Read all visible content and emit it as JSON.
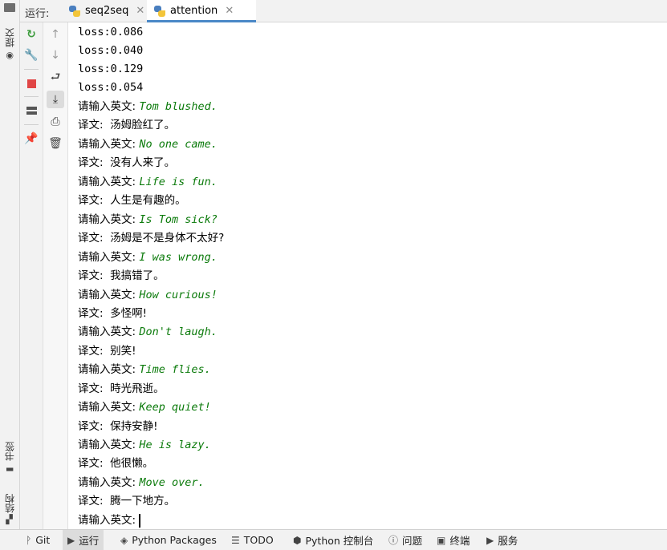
{
  "left_strip": {
    "commit_label": "提交",
    "bookmarks_label": "书签",
    "structure_label": "结构"
  },
  "tabbar": {
    "run_label": "运行:",
    "tabs": [
      {
        "label": "seq2seq",
        "active": false
      },
      {
        "label": "attention",
        "active": true
      }
    ]
  },
  "toolbar": {
    "icons": [
      "rerun-icon",
      "settings-wrench-icon",
      "stop-icon",
      "layout-icon",
      "pin-icon"
    ],
    "secondary_icons": [
      "up-arrow-icon",
      "down-arrow-icon",
      "soft-wrap-icon",
      "scroll-to-end-icon",
      "print-icon",
      "trash-icon"
    ]
  },
  "console": {
    "losses": [
      "loss:0.086",
      "loss:0.040",
      "loss:0.129",
      "loss:0.054"
    ],
    "prompt_label": "请输入英文:",
    "translation_label": "译文:",
    "exchanges": [
      {
        "input": "Tom blushed.",
        "output": "汤姆脸红了。"
      },
      {
        "input": "No one came.",
        "output": "没有人来了。"
      },
      {
        "input": "Life is fun.",
        "output": "人生是有趣的。"
      },
      {
        "input": "Is Tom sick?",
        "output": "汤姆是不是身体不太好?"
      },
      {
        "input": "I was wrong.",
        "output": "我搞错了。"
      },
      {
        "input": "How curious!",
        "output": "多怪啊!"
      },
      {
        "input": "Don't laugh.",
        "output": "别笑!"
      },
      {
        "input": "Time flies.",
        "output": "時光飛逝。"
      },
      {
        "input": "Keep quiet!",
        "output": "保持安静!"
      },
      {
        "input": "He is lazy.",
        "output": "他很懒。"
      },
      {
        "input": "Move over.",
        "output": "腾一下地方。"
      }
    ],
    "final_prompt": "请输入英文:"
  },
  "bottombar": {
    "items": [
      {
        "label": "Git",
        "icon": "git-branch-icon"
      },
      {
        "label": "运行",
        "icon": "run-play-icon",
        "active": true
      },
      {
        "label": "Python Packages",
        "icon": "packages-icon"
      },
      {
        "label": "TODO",
        "icon": "todo-list-icon"
      },
      {
        "label": "Python 控制台",
        "icon": "python-console-icon"
      },
      {
        "label": "问题",
        "icon": "problems-icon"
      },
      {
        "label": "终端",
        "icon": "terminal-icon"
      },
      {
        "label": "服务",
        "icon": "services-icon"
      }
    ]
  },
  "colors": {
    "input_green": "#0a7a0a",
    "tab_underline": "#4a88c7",
    "rerun_green": "#3c9b3c",
    "stop_red": "#e04545"
  }
}
